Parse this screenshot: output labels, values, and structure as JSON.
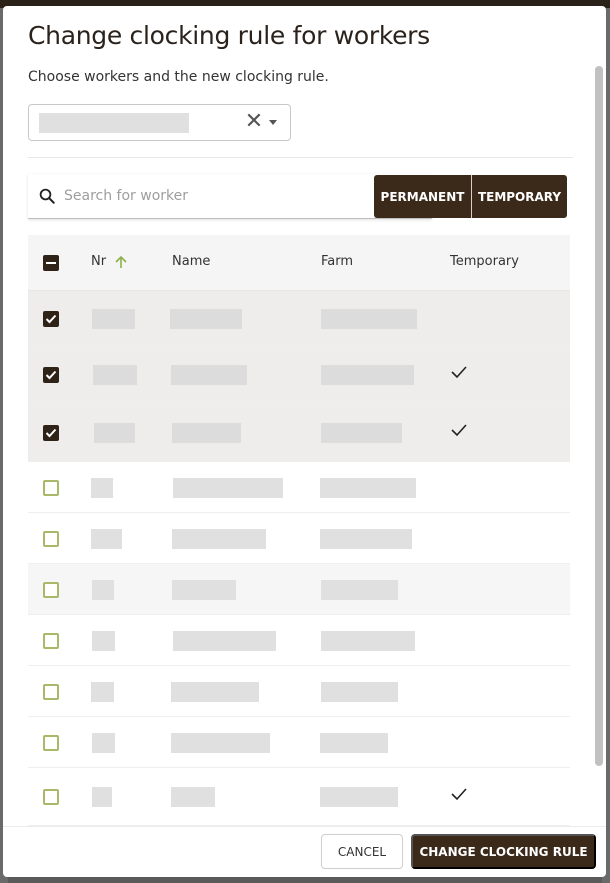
{
  "dialog": {
    "title": "Change clocking rule for workers",
    "subtitle": "Choose workers and the new clocking rule."
  },
  "search": {
    "placeholder": "Search for worker"
  },
  "filters": {
    "permanent_label": "PERMANENT",
    "temporary_label": "TEMPORARY"
  },
  "table": {
    "columns": [
      "Nr",
      "Name",
      "Farm",
      "Temporary"
    ],
    "sort_column": "Nr",
    "sort_direction": "ascending",
    "rows": [
      {
        "selected": true,
        "temporary": false
      },
      {
        "selected": true,
        "temporary": true
      },
      {
        "selected": true,
        "temporary": true
      },
      {
        "selected": false,
        "temporary": false
      },
      {
        "selected": false,
        "temporary": false
      },
      {
        "selected": false,
        "temporary": false
      },
      {
        "selected": false,
        "temporary": false
      },
      {
        "selected": false,
        "temporary": false
      },
      {
        "selected": false,
        "temporary": false
      },
      {
        "selected": false,
        "temporary": true
      }
    ]
  },
  "footer": {
    "cancel_label": "CANCEL",
    "confirm_label": "CHANGE CLOCKING RULE"
  },
  "colors": {
    "primary_dark": "#3b2a1a",
    "checkbox_outline": "#a8b96a",
    "sort_arrow": "#8bb04a"
  }
}
